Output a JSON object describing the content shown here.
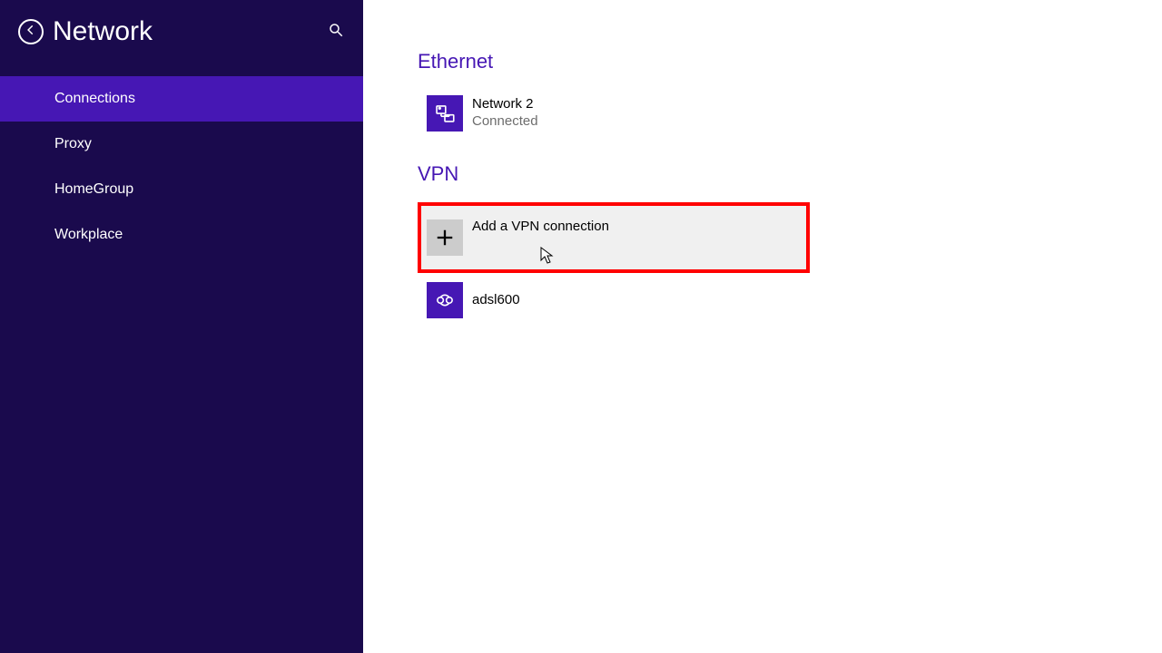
{
  "colors": {
    "sidebar_bg": "#1a0a4d",
    "accent": "#4617b4",
    "highlight_border": "#ff0000"
  },
  "header": {
    "title": "Network"
  },
  "sidebar": {
    "items": [
      {
        "label": "Connections",
        "active": true
      },
      {
        "label": "Proxy",
        "active": false
      },
      {
        "label": "HomeGroup",
        "active": false
      },
      {
        "label": "Workplace",
        "active": false
      }
    ]
  },
  "content": {
    "ethernet": {
      "heading": "Ethernet",
      "connection": {
        "name": "Network  2",
        "status": "Connected"
      }
    },
    "vpn": {
      "heading": "VPN",
      "add_label": "Add a VPN connection",
      "connections": [
        {
          "name": "adsl600"
        }
      ]
    }
  }
}
